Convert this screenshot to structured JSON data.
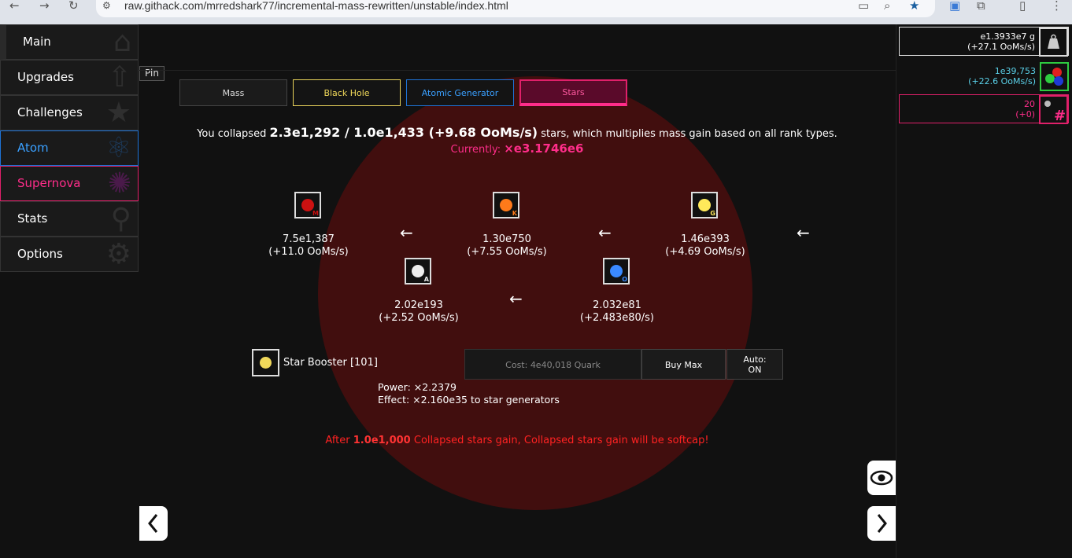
{
  "browser": {
    "url": "raw.githack.com/mrredshark77/incremental-mass-rewritten/unstable/index.html",
    "icons": [
      "back-icon",
      "forward-icon",
      "reload-icon",
      "site-info-icon",
      "install-icon",
      "zoom-icon",
      "bookmark-star-icon",
      "extension-icon",
      "puzzle-icon",
      "sidebar-icon",
      "menu-icon"
    ]
  },
  "sidebar": {
    "items": [
      {
        "label": "Main"
      },
      {
        "label": "Upgrades"
      },
      {
        "label": "Challenges"
      },
      {
        "label": "Atom"
      },
      {
        "label": "Supernova"
      },
      {
        "label": "Stats"
      },
      {
        "label": "Options"
      }
    ]
  },
  "pin_label": "Pin",
  "tabs": [
    {
      "label": "Mass"
    },
    {
      "label": "Black Hole"
    },
    {
      "label": "Atomic Generator"
    },
    {
      "label": "Stars"
    }
  ],
  "stars": {
    "prefix": "You collapsed",
    "collapsed": "2.3e1,292 / 1.0e1,433 (+9.68 OoMs/s)",
    "suffix": "stars, which multiplies mass gain based on all rank types.",
    "currently_label": "Currently:",
    "currently_value": "×e3.1746e6",
    "generators": [
      {
        "letter": "M",
        "value": "7.5e1,387",
        "rate": "(+11.0 OoMs/s)",
        "color": "#cc1111"
      },
      {
        "letter": "K",
        "value": "1.30e750",
        "rate": "(+7.55 OoMs/s)",
        "color": "#ff7a1a"
      },
      {
        "letter": "G",
        "value": "1.46e393",
        "rate": "(+4.69 OoMs/s)",
        "color": "#ffe95a"
      },
      {
        "letter": "A",
        "value": "2.02e193",
        "rate": "(+2.52 OoMs/s)",
        "color": "#eeeeee"
      },
      {
        "letter": "O",
        "value": "2.032e81",
        "rate": "(+2.483e80/s)",
        "color": "#3a8aff"
      }
    ],
    "arrow": "←"
  },
  "booster": {
    "title": "Star Booster [101]",
    "cost": "Cost: 4e40,018 Quark",
    "buy_max": "Buy Max",
    "auto_line1": "Auto:",
    "auto_line2": "ON",
    "power": "Power: ×2.2379",
    "effect": "Effect: ×2.160e35 to star generators"
  },
  "softcap": {
    "prefix": "After",
    "value": "1.0e1,000",
    "suffix": "Collapsed stars gain, Collapsed stars gain will be softcap!"
  },
  "resources": {
    "mass": {
      "value": "e1.3933e7 g",
      "rate": "(+27.1 OoMs/s)"
    },
    "quark": {
      "value": "1e39,753",
      "rate": "(+22.6 OoMs/s)"
    },
    "supernova": {
      "value": "20",
      "rate": "(+0)"
    }
  },
  "nav_buttons": {
    "left": "‹",
    "right": "›"
  }
}
